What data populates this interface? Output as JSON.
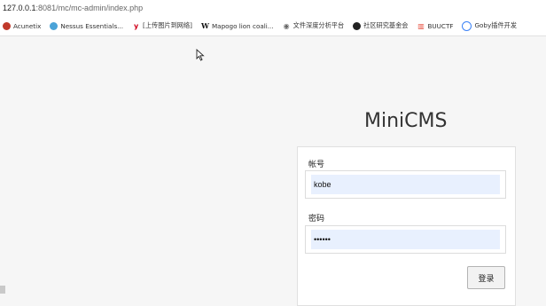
{
  "address_bar": {
    "host": "127.0.0.1",
    "rest": ":8081/mc/mc-admin/index.php"
  },
  "bookmarks": [
    {
      "label": "Acunetix",
      "icon": "acunetix-icon"
    },
    {
      "label": "Nessus Essentials...",
      "icon": "nessus-icon"
    },
    {
      "label": "[上传图片到网络]",
      "icon": "y-icon"
    },
    {
      "label": "Mapogo lion coali...",
      "icon": "wikipedia-icon"
    },
    {
      "label": "文件深度分析平台",
      "icon": "file-analysis-icon"
    },
    {
      "label": "社区研究基金会",
      "icon": "github-icon"
    },
    {
      "label": "BUUCTF",
      "icon": "buuctf-icon"
    },
    {
      "label": "Goby插件开发",
      "icon": "goby-icon"
    }
  ],
  "page": {
    "title": "MiniCMS"
  },
  "form": {
    "username_label": "帐号",
    "username_value": "kobe",
    "password_label": "密码",
    "password_value": "••••••",
    "submit_label": "登录"
  }
}
